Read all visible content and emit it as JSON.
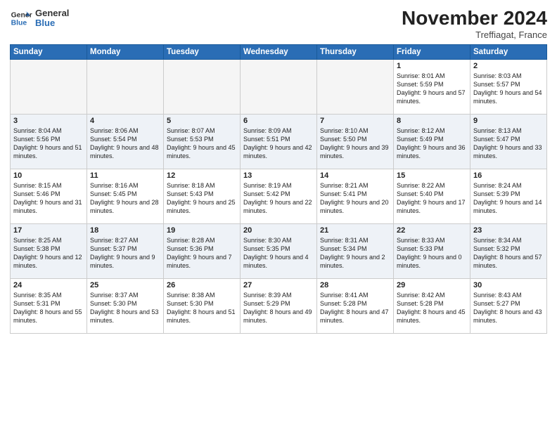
{
  "header": {
    "logo_line1": "General",
    "logo_line2": "Blue",
    "month_title": "November 2024",
    "location": "Treffiagat, France"
  },
  "weekdays": [
    "Sunday",
    "Monday",
    "Tuesday",
    "Wednesday",
    "Thursday",
    "Friday",
    "Saturday"
  ],
  "weeks": [
    [
      {
        "day": "",
        "info": ""
      },
      {
        "day": "",
        "info": ""
      },
      {
        "day": "",
        "info": ""
      },
      {
        "day": "",
        "info": ""
      },
      {
        "day": "",
        "info": ""
      },
      {
        "day": "1",
        "info": "Sunrise: 8:01 AM\nSunset: 5:59 PM\nDaylight: 9 hours and 57 minutes."
      },
      {
        "day": "2",
        "info": "Sunrise: 8:03 AM\nSunset: 5:57 PM\nDaylight: 9 hours and 54 minutes."
      }
    ],
    [
      {
        "day": "3",
        "info": "Sunrise: 8:04 AM\nSunset: 5:56 PM\nDaylight: 9 hours and 51 minutes."
      },
      {
        "day": "4",
        "info": "Sunrise: 8:06 AM\nSunset: 5:54 PM\nDaylight: 9 hours and 48 minutes."
      },
      {
        "day": "5",
        "info": "Sunrise: 8:07 AM\nSunset: 5:53 PM\nDaylight: 9 hours and 45 minutes."
      },
      {
        "day": "6",
        "info": "Sunrise: 8:09 AM\nSunset: 5:51 PM\nDaylight: 9 hours and 42 minutes."
      },
      {
        "day": "7",
        "info": "Sunrise: 8:10 AM\nSunset: 5:50 PM\nDaylight: 9 hours and 39 minutes."
      },
      {
        "day": "8",
        "info": "Sunrise: 8:12 AM\nSunset: 5:49 PM\nDaylight: 9 hours and 36 minutes."
      },
      {
        "day": "9",
        "info": "Sunrise: 8:13 AM\nSunset: 5:47 PM\nDaylight: 9 hours and 33 minutes."
      }
    ],
    [
      {
        "day": "10",
        "info": "Sunrise: 8:15 AM\nSunset: 5:46 PM\nDaylight: 9 hours and 31 minutes."
      },
      {
        "day": "11",
        "info": "Sunrise: 8:16 AM\nSunset: 5:45 PM\nDaylight: 9 hours and 28 minutes."
      },
      {
        "day": "12",
        "info": "Sunrise: 8:18 AM\nSunset: 5:43 PM\nDaylight: 9 hours and 25 minutes."
      },
      {
        "day": "13",
        "info": "Sunrise: 8:19 AM\nSunset: 5:42 PM\nDaylight: 9 hours and 22 minutes."
      },
      {
        "day": "14",
        "info": "Sunrise: 8:21 AM\nSunset: 5:41 PM\nDaylight: 9 hours and 20 minutes."
      },
      {
        "day": "15",
        "info": "Sunrise: 8:22 AM\nSunset: 5:40 PM\nDaylight: 9 hours and 17 minutes."
      },
      {
        "day": "16",
        "info": "Sunrise: 8:24 AM\nSunset: 5:39 PM\nDaylight: 9 hours and 14 minutes."
      }
    ],
    [
      {
        "day": "17",
        "info": "Sunrise: 8:25 AM\nSunset: 5:38 PM\nDaylight: 9 hours and 12 minutes."
      },
      {
        "day": "18",
        "info": "Sunrise: 8:27 AM\nSunset: 5:37 PM\nDaylight: 9 hours and 9 minutes."
      },
      {
        "day": "19",
        "info": "Sunrise: 8:28 AM\nSunset: 5:36 PM\nDaylight: 9 hours and 7 minutes."
      },
      {
        "day": "20",
        "info": "Sunrise: 8:30 AM\nSunset: 5:35 PM\nDaylight: 9 hours and 4 minutes."
      },
      {
        "day": "21",
        "info": "Sunrise: 8:31 AM\nSunset: 5:34 PM\nDaylight: 9 hours and 2 minutes."
      },
      {
        "day": "22",
        "info": "Sunrise: 8:33 AM\nSunset: 5:33 PM\nDaylight: 9 hours and 0 minutes."
      },
      {
        "day": "23",
        "info": "Sunrise: 8:34 AM\nSunset: 5:32 PM\nDaylight: 8 hours and 57 minutes."
      }
    ],
    [
      {
        "day": "24",
        "info": "Sunrise: 8:35 AM\nSunset: 5:31 PM\nDaylight: 8 hours and 55 minutes."
      },
      {
        "day": "25",
        "info": "Sunrise: 8:37 AM\nSunset: 5:30 PM\nDaylight: 8 hours and 53 minutes."
      },
      {
        "day": "26",
        "info": "Sunrise: 8:38 AM\nSunset: 5:30 PM\nDaylight: 8 hours and 51 minutes."
      },
      {
        "day": "27",
        "info": "Sunrise: 8:39 AM\nSunset: 5:29 PM\nDaylight: 8 hours and 49 minutes."
      },
      {
        "day": "28",
        "info": "Sunrise: 8:41 AM\nSunset: 5:28 PM\nDaylight: 8 hours and 47 minutes."
      },
      {
        "day": "29",
        "info": "Sunrise: 8:42 AM\nSunset: 5:28 PM\nDaylight: 8 hours and 45 minutes."
      },
      {
        "day": "30",
        "info": "Sunrise: 8:43 AM\nSunset: 5:27 PM\nDaylight: 8 hours and 43 minutes."
      }
    ]
  ]
}
